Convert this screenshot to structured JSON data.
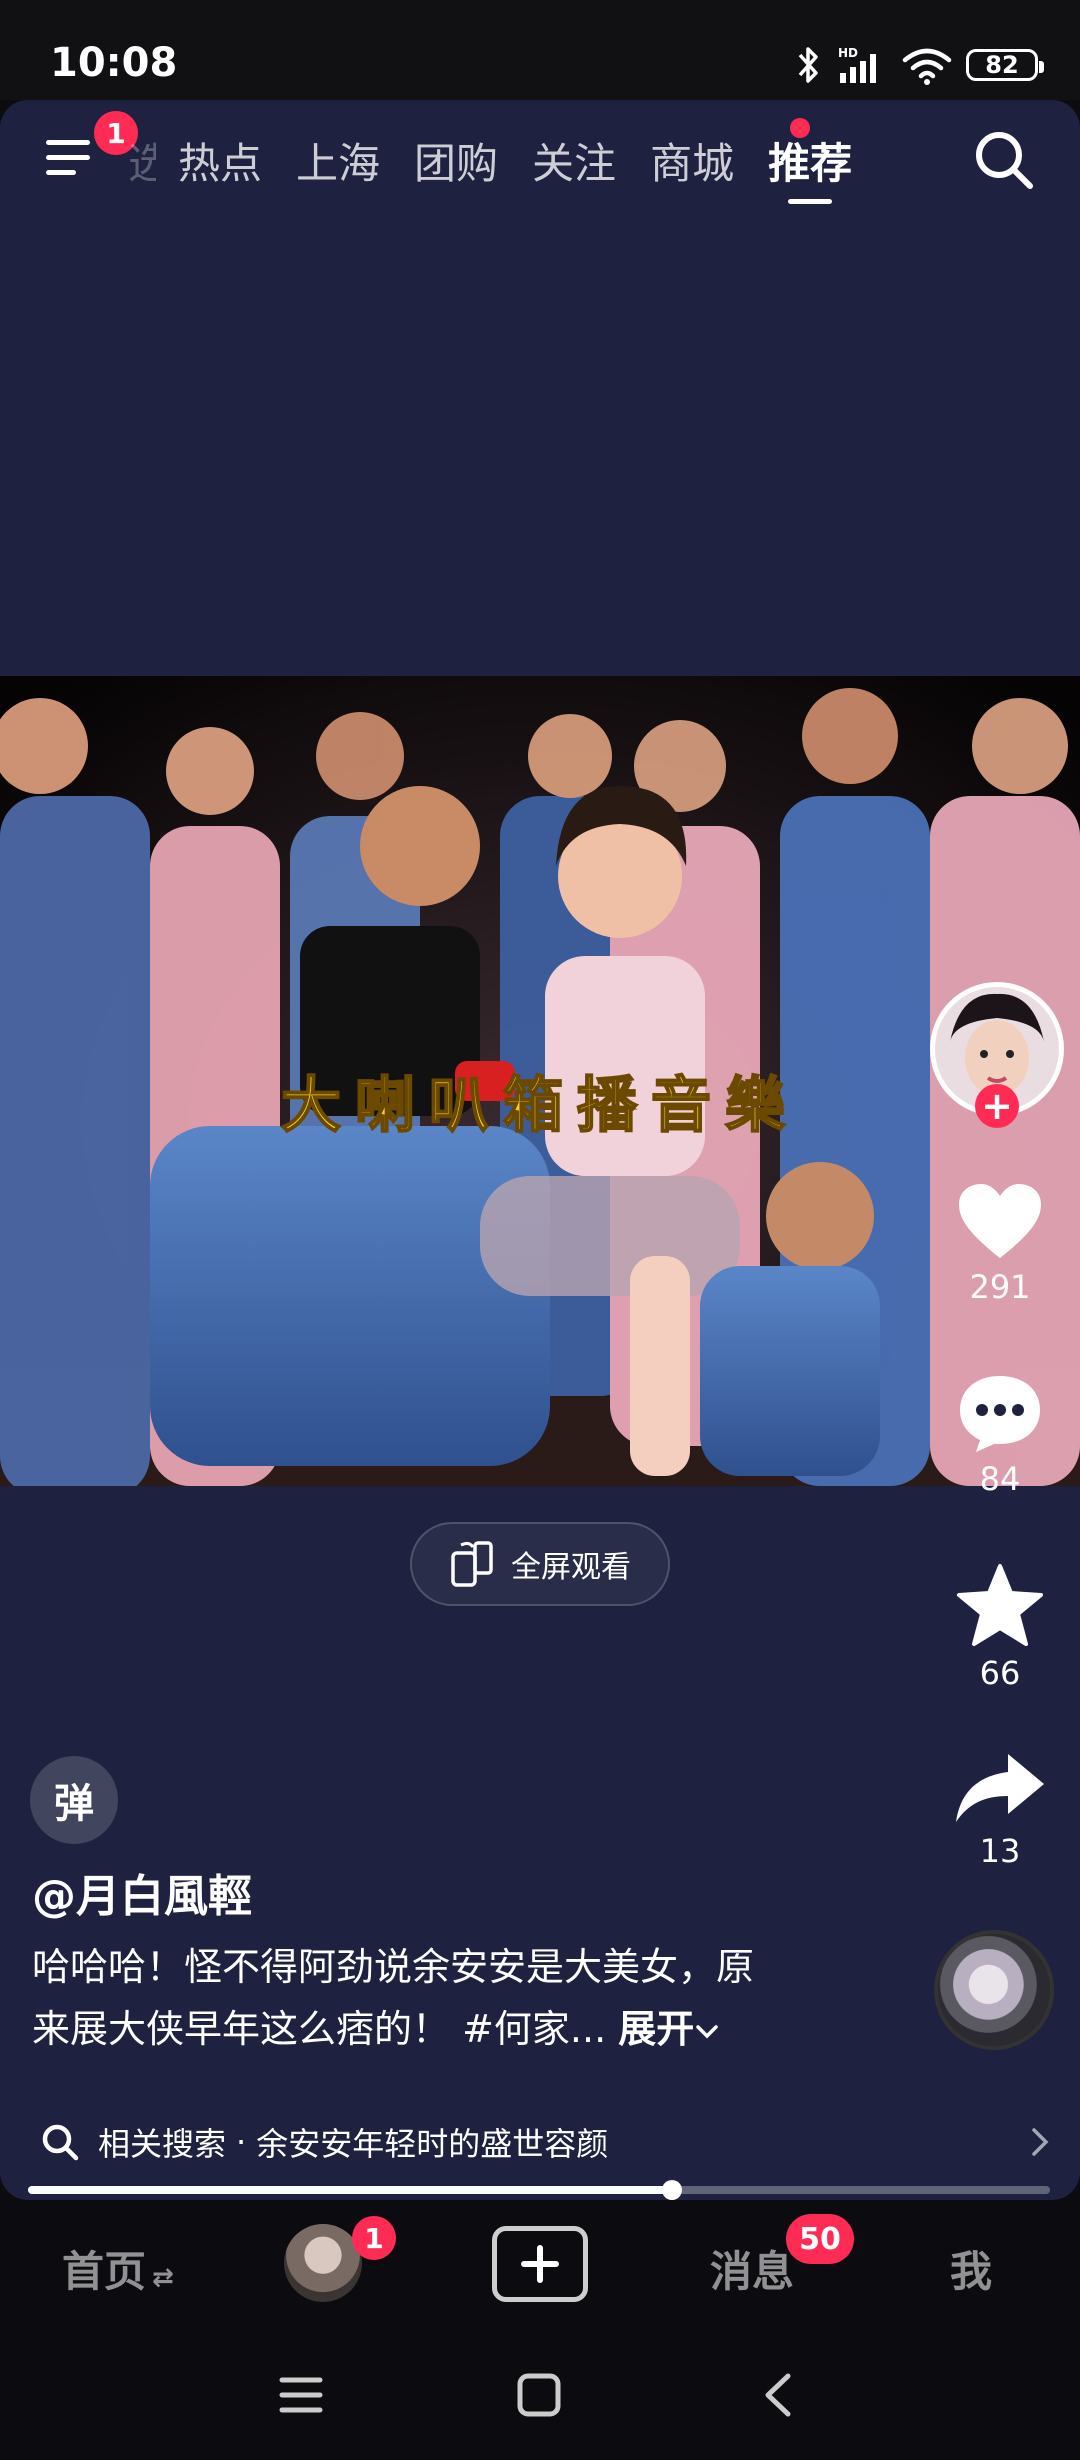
{
  "status_bar": {
    "time": "10:08",
    "battery": "82",
    "icons": [
      "bluetooth-icon",
      "hd-signal-icon",
      "wifi-icon",
      "battery-icon"
    ]
  },
  "top_nav": {
    "menu_badge": "1",
    "partial_tab": "选",
    "tabs": [
      {
        "label": "热点",
        "active": false,
        "dot": false
      },
      {
        "label": "上海",
        "active": false,
        "dot": false
      },
      {
        "label": "团购",
        "active": false,
        "dot": false
      },
      {
        "label": "关注",
        "active": false,
        "dot": false
      },
      {
        "label": "商城",
        "active": false,
        "dot": true
      },
      {
        "label": "推荐",
        "active": true,
        "dot": false
      }
    ]
  },
  "video": {
    "subtitle": "大喇叭箱播音樂"
  },
  "fullscreen_button": {
    "label": "全屏观看"
  },
  "right_rail": {
    "likes": "291",
    "comments": "84",
    "favorites": "66",
    "shares": "13"
  },
  "danmu_label": "弹",
  "post": {
    "author": "@月白風輕",
    "caption_line1": "哈哈哈！怪不得阿劲说余安安是大美女，原",
    "caption_line2": "来展大侠早年这么痞的！ #何家...",
    "expand_label": "展开"
  },
  "related_search": {
    "prefix": "相关搜索",
    "separator": "·",
    "query": "余安安年轻时的盛世容颜"
  },
  "progress": {
    "fraction": 0.63
  },
  "bottom_nav": {
    "home": "首页",
    "friends_badge": "1",
    "messages": "消息",
    "messages_badge": "50",
    "me": "我"
  },
  "colors": {
    "background": "#1e2240",
    "accent_red": "#fe2c55",
    "subtitle_yellow": "#f2d21a"
  }
}
